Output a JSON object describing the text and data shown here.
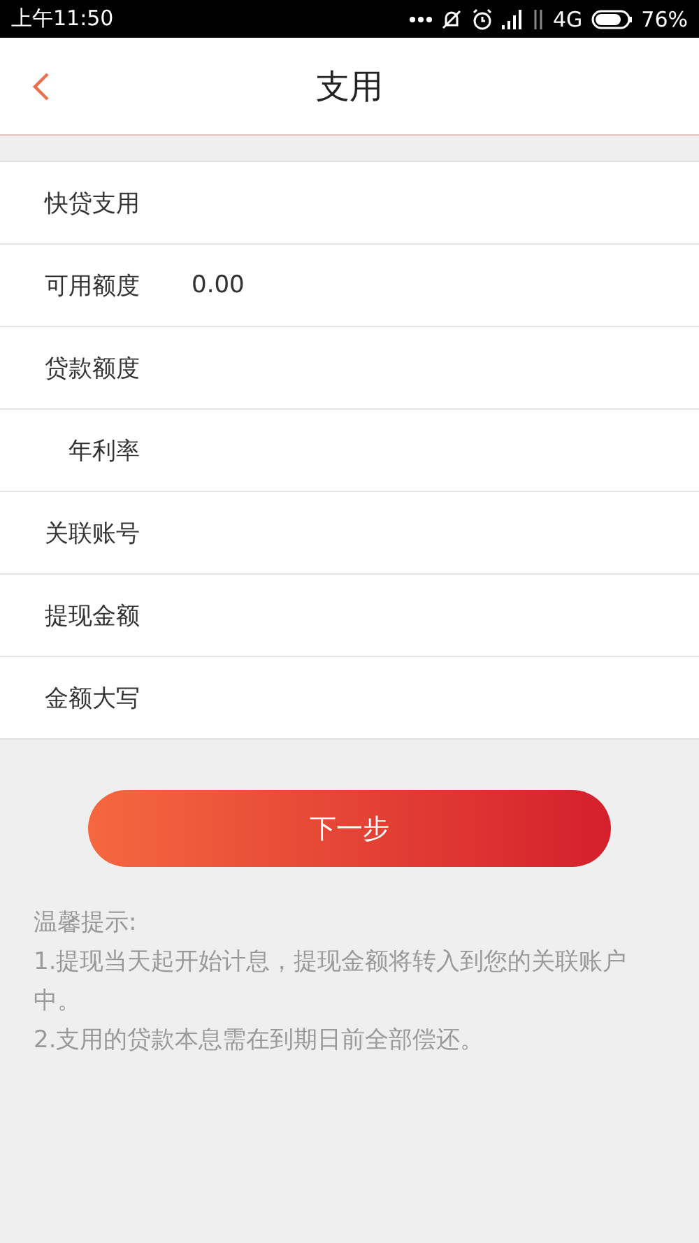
{
  "status_bar": {
    "time": "上午11:50",
    "network": "4G",
    "battery": "76%"
  },
  "header": {
    "title": "支用"
  },
  "rows": [
    {
      "label": "快贷支用"
    },
    {
      "label": "可用额度",
      "value": "0.00"
    },
    {
      "label": "贷款额度"
    },
    {
      "label": "年利率"
    },
    {
      "label": "关联账号"
    },
    {
      "label": "提现金额"
    },
    {
      "label": "金额大写"
    }
  ],
  "button": {
    "label": "下一步"
  },
  "tips": {
    "title": "温馨提示:",
    "lines": [
      "1.提现当天起开始计息，提现金额将转入到您的关联账户中。",
      "2.支用的贷款本息需在到期日前全部偿还。"
    ]
  }
}
